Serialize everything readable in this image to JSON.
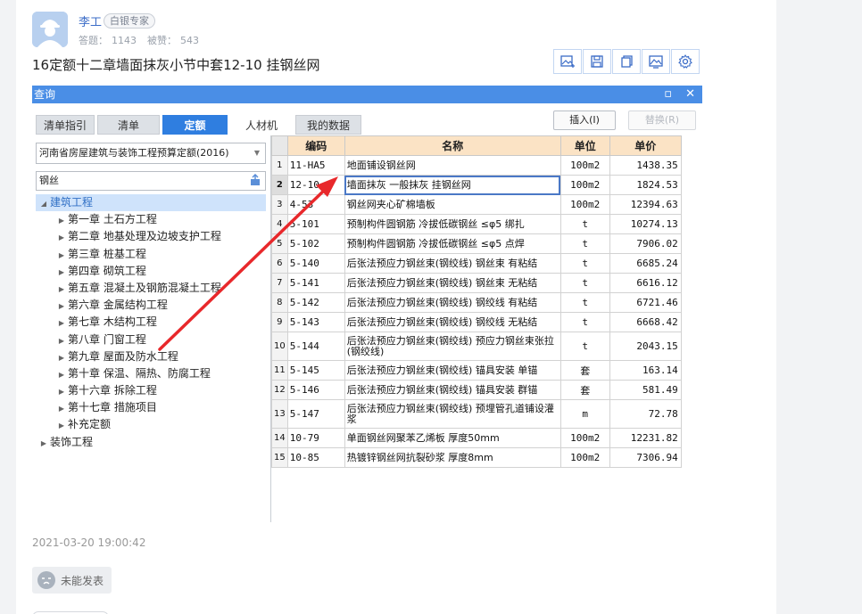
{
  "author": {
    "name": "李工",
    "badge": "白银专家",
    "answers_label": "答题：",
    "answers": "1143",
    "likes_label": "被赞：",
    "likes": "543"
  },
  "post": {
    "title": "16定额十二章墙面抹灰小节中套12-10 挂钢丝网",
    "timestamp": "2021-03-20 19:00:42",
    "status_label": "未能发表"
  },
  "toolbar": {
    "icons": [
      "image-edit-icon",
      "save-icon",
      "copy-icon",
      "image-icon",
      "settings-icon"
    ]
  },
  "dialog": {
    "title": "查询",
    "min_label": "▫",
    "close_label": "✕",
    "tabs": [
      "清单指引",
      "清单",
      "定额",
      "人材机",
      "我的数据"
    ],
    "active_tab": "定额",
    "insert_label": "插入(I)",
    "replace_label": "替换(R)",
    "quota_book": "河南省房屋建筑与装饰工程预算定额(2016)",
    "search_value": "钢丝",
    "tree": [
      {
        "label": "建筑工程",
        "level": 0,
        "expanded": true
      },
      {
        "label": "第一章 土石方工程",
        "level": 1
      },
      {
        "label": "第二章 地基处理及边坡支护工程",
        "level": 1
      },
      {
        "label": "第三章 桩基工程",
        "level": 1
      },
      {
        "label": "第四章 砌筑工程",
        "level": 1
      },
      {
        "label": "第五章 混凝土及钢筋混凝土工程",
        "level": 1
      },
      {
        "label": "第六章 金属结构工程",
        "level": 1
      },
      {
        "label": "第七章 木结构工程",
        "level": 1
      },
      {
        "label": "第八章 门窗工程",
        "level": 1
      },
      {
        "label": "第九章 屋面及防水工程",
        "level": 1
      },
      {
        "label": "第十章 保温、隔热、防腐工程",
        "level": 1
      },
      {
        "label": "第十六章 拆除工程",
        "level": 1
      },
      {
        "label": "第十七章 措施项目",
        "level": 1
      },
      {
        "label": "补充定额",
        "level": 1
      },
      {
        "label": "装饰工程",
        "level": 0,
        "expanded": false
      }
    ],
    "table": {
      "headers": [
        "编码",
        "名称",
        "单位",
        "单价"
      ],
      "rows": [
        {
          "n": "1",
          "code": "11-HA5",
          "name": "地面铺设钢丝网",
          "unit": "100m2",
          "price": "1438.35"
        },
        {
          "n": "2",
          "code": "12-10",
          "name": "墙面抹灰 一般抹灰 挂钢丝网",
          "unit": "100m2",
          "price": "1824.53"
        },
        {
          "n": "3",
          "code": "4-53",
          "name": "钢丝网夹心矿棉墙板",
          "unit": "100m2",
          "price": "12394.63"
        },
        {
          "n": "4",
          "code": "5-101",
          "name": "预制构件圆钢筋 冷拔低碳钢丝 ≤φ5 绑扎",
          "unit": "t",
          "price": "10274.13"
        },
        {
          "n": "5",
          "code": "5-102",
          "name": "预制构件圆钢筋 冷拔低碳钢丝 ≤φ5 点焊",
          "unit": "t",
          "price": "7906.02"
        },
        {
          "n": "6",
          "code": "5-140",
          "name": "后张法预应力钢丝束(钢绞线) 钢丝束 有粘结",
          "unit": "t",
          "price": "6685.24"
        },
        {
          "n": "7",
          "code": "5-141",
          "name": "后张法预应力钢丝束(钢绞线) 钢丝束 无粘结",
          "unit": "t",
          "price": "6616.12"
        },
        {
          "n": "8",
          "code": "5-142",
          "name": "后张法预应力钢丝束(钢绞线) 钢绞线 有粘结",
          "unit": "t",
          "price": "6721.46"
        },
        {
          "n": "9",
          "code": "5-143",
          "name": "后张法预应力钢丝束(钢绞线) 钢绞线 无粘结",
          "unit": "t",
          "price": "6668.42"
        },
        {
          "n": "10",
          "code": "5-144",
          "name": "后张法预应力钢丝束(钢绞线) 预应力钢丝束张拉 (钢绞线)",
          "unit": "t",
          "price": "2043.15"
        },
        {
          "n": "11",
          "code": "5-145",
          "name": "后张法预应力钢丝束(钢绞线) 锚具安装 单锚",
          "unit": "套",
          "price": "163.14"
        },
        {
          "n": "12",
          "code": "5-146",
          "name": "后张法预应力钢丝束(钢绞线) 锚具安装 群锚",
          "unit": "套",
          "price": "581.49"
        },
        {
          "n": "13",
          "code": "5-147",
          "name": "后张法预应力钢丝束(钢绞线) 预埋管孔道铺设灌浆",
          "unit": "m",
          "price": "72.78"
        },
        {
          "n": "14",
          "code": "10-79",
          "name": "单面钢丝网聚苯乙烯板 厚度50mm",
          "unit": "100m2",
          "price": "12231.82"
        },
        {
          "n": "15",
          "code": "10-85",
          "name": "热镀锌钢丝网抗裂砂浆 厚度8mm",
          "unit": "100m2",
          "price": "7306.94"
        }
      ]
    }
  },
  "colors": {
    "accent": "#2f7ee0",
    "titlebar": "#4a8ee6",
    "header_bg": "#fbe3c5",
    "annotation_arrow": "#e8282b"
  }
}
